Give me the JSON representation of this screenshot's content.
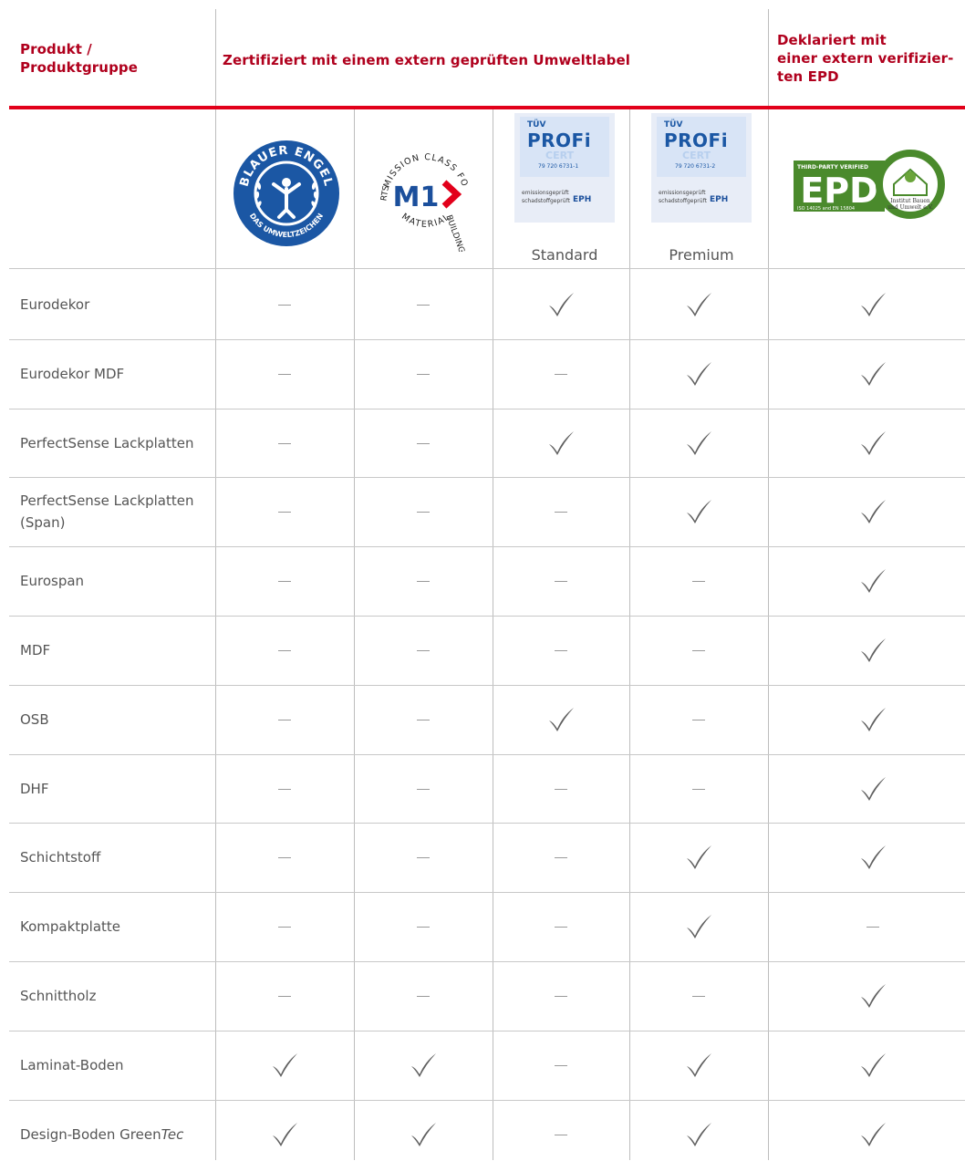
{
  "header": {
    "col_product": [
      "Produkt /",
      "Produktgruppe"
    ],
    "col_certified": "Zertifiziert mit einem extern geprüften Umweltlabel",
    "col_epd": [
      "Deklariert mit",
      "einer extern verifizier-",
      "ten EPD"
    ]
  },
  "logos": {
    "blauer_engel": {
      "top": "BLAUER ENGEL",
      "bottom": "DAS UMWELTZEICHEN"
    },
    "m1": {
      "mark": "M1",
      "ring_top": "EMISSION CLASS FOR",
      "ring_right": "BUILDING",
      "ring_bottom": "MATERIAL",
      "ring_left": "RTS"
    },
    "tuv_standard": {
      "brand": "TÜV",
      "title": "PROFi",
      "sub": "CERT",
      "number": "79 720 6731-1",
      "line1": "emissionsgeprüft",
      "line2": "schadstoffgeprüft",
      "eph": "EPH",
      "caption": "Standard"
    },
    "tuv_premium": {
      "brand": "TÜV",
      "title": "PROFi",
      "sub": "CERT",
      "number": "79 720 6731-2",
      "line1": "emissionsgeprüft",
      "line2": "schadstoffgeprüft",
      "eph": "EPH",
      "caption": "Premium"
    },
    "epd": {
      "verified": "THIRD-PARTY VERIFIED",
      "mark": "EPD",
      "iso": "ISO 14025 and EN 15804",
      "institut": [
        "Institut Bauen",
        "und Umwelt e.V."
      ]
    }
  },
  "rows": [
    {
      "label": "Eurodekor",
      "values": [
        false,
        false,
        true,
        true,
        true
      ]
    },
    {
      "label": "Eurodekor MDF",
      "values": [
        false,
        false,
        false,
        true,
        true
      ]
    },
    {
      "label": "PerfectSense Lackplatten",
      "values": [
        false,
        false,
        true,
        true,
        true
      ]
    },
    {
      "label": "PerfectSense Lackplatten (Span)",
      "values": [
        false,
        false,
        false,
        true,
        true
      ]
    },
    {
      "label": "Eurospan",
      "values": [
        false,
        false,
        false,
        false,
        true
      ]
    },
    {
      "label": "MDF",
      "values": [
        false,
        false,
        false,
        false,
        true
      ]
    },
    {
      "label": "OSB",
      "values": [
        false,
        false,
        true,
        false,
        true
      ]
    },
    {
      "label": "DHF",
      "values": [
        false,
        false,
        false,
        false,
        true
      ]
    },
    {
      "label": "Schichtstoff",
      "values": [
        false,
        false,
        false,
        true,
        true
      ]
    },
    {
      "label": "Kompaktplatte",
      "values": [
        false,
        false,
        false,
        true,
        false
      ]
    },
    {
      "label": "Schnittholz",
      "values": [
        false,
        false,
        false,
        false,
        true
      ]
    },
    {
      "label": "Laminat-Boden",
      "values": [
        true,
        true,
        false,
        true,
        true
      ]
    },
    {
      "label": "Design-Boden Green",
      "label_italic": "Tec",
      "values": [
        true,
        true,
        false,
        true,
        true
      ]
    }
  ],
  "colors": {
    "accent": "#b0001d",
    "rule": "#e2001a",
    "check": "#5f5f5f",
    "blue": "#1b57a4",
    "epd_green": "#4a8a2c"
  }
}
